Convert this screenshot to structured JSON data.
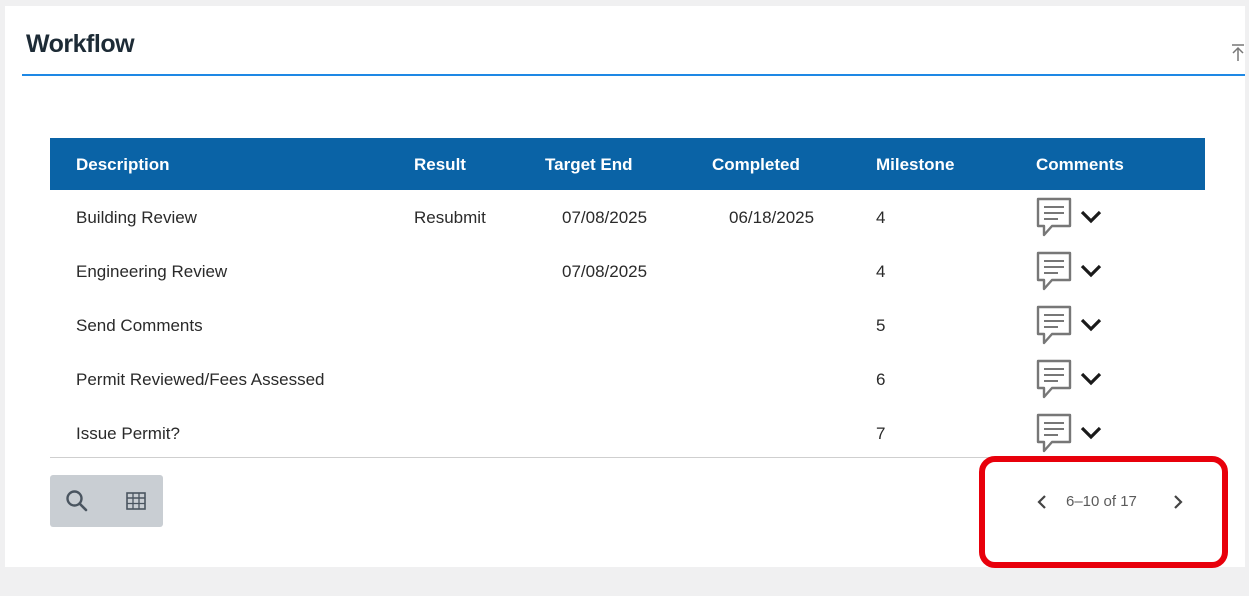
{
  "panel": {
    "title": "Workflow"
  },
  "table": {
    "columns": {
      "description": "Description",
      "result": "Result",
      "target_end": "Target End",
      "completed": "Completed",
      "milestone": "Milestone",
      "comments": "Comments"
    },
    "rows": [
      {
        "description": "Building Review",
        "result": "Resubmit",
        "target_end": "07/08/2025",
        "completed": "06/18/2025",
        "milestone": "4"
      },
      {
        "description": "Engineering Review",
        "result": "",
        "target_end": "07/08/2025",
        "completed": "",
        "milestone": "4"
      },
      {
        "description": "Send Comments",
        "result": "",
        "target_end": "",
        "completed": "",
        "milestone": "5"
      },
      {
        "description": "Permit Reviewed/Fees Assessed",
        "result": "",
        "target_end": "",
        "completed": "",
        "milestone": "6"
      },
      {
        "description": "Issue Permit?",
        "result": "",
        "target_end": "",
        "completed": "",
        "milestone": "7"
      }
    ]
  },
  "pagination": {
    "range_text": "6–10 of 17"
  },
  "icons": {
    "collapse": "collapse-up-icon",
    "comment": "comment-icon",
    "expand": "chevron-down-icon",
    "search": "search-icon",
    "columns": "table-columns-icon",
    "prev": "chevron-left-icon",
    "next": "chevron-right-icon"
  },
  "colors": {
    "header_bg": "#0a63a6",
    "title_underline": "#1e88e5",
    "highlight": "#e8000b"
  }
}
